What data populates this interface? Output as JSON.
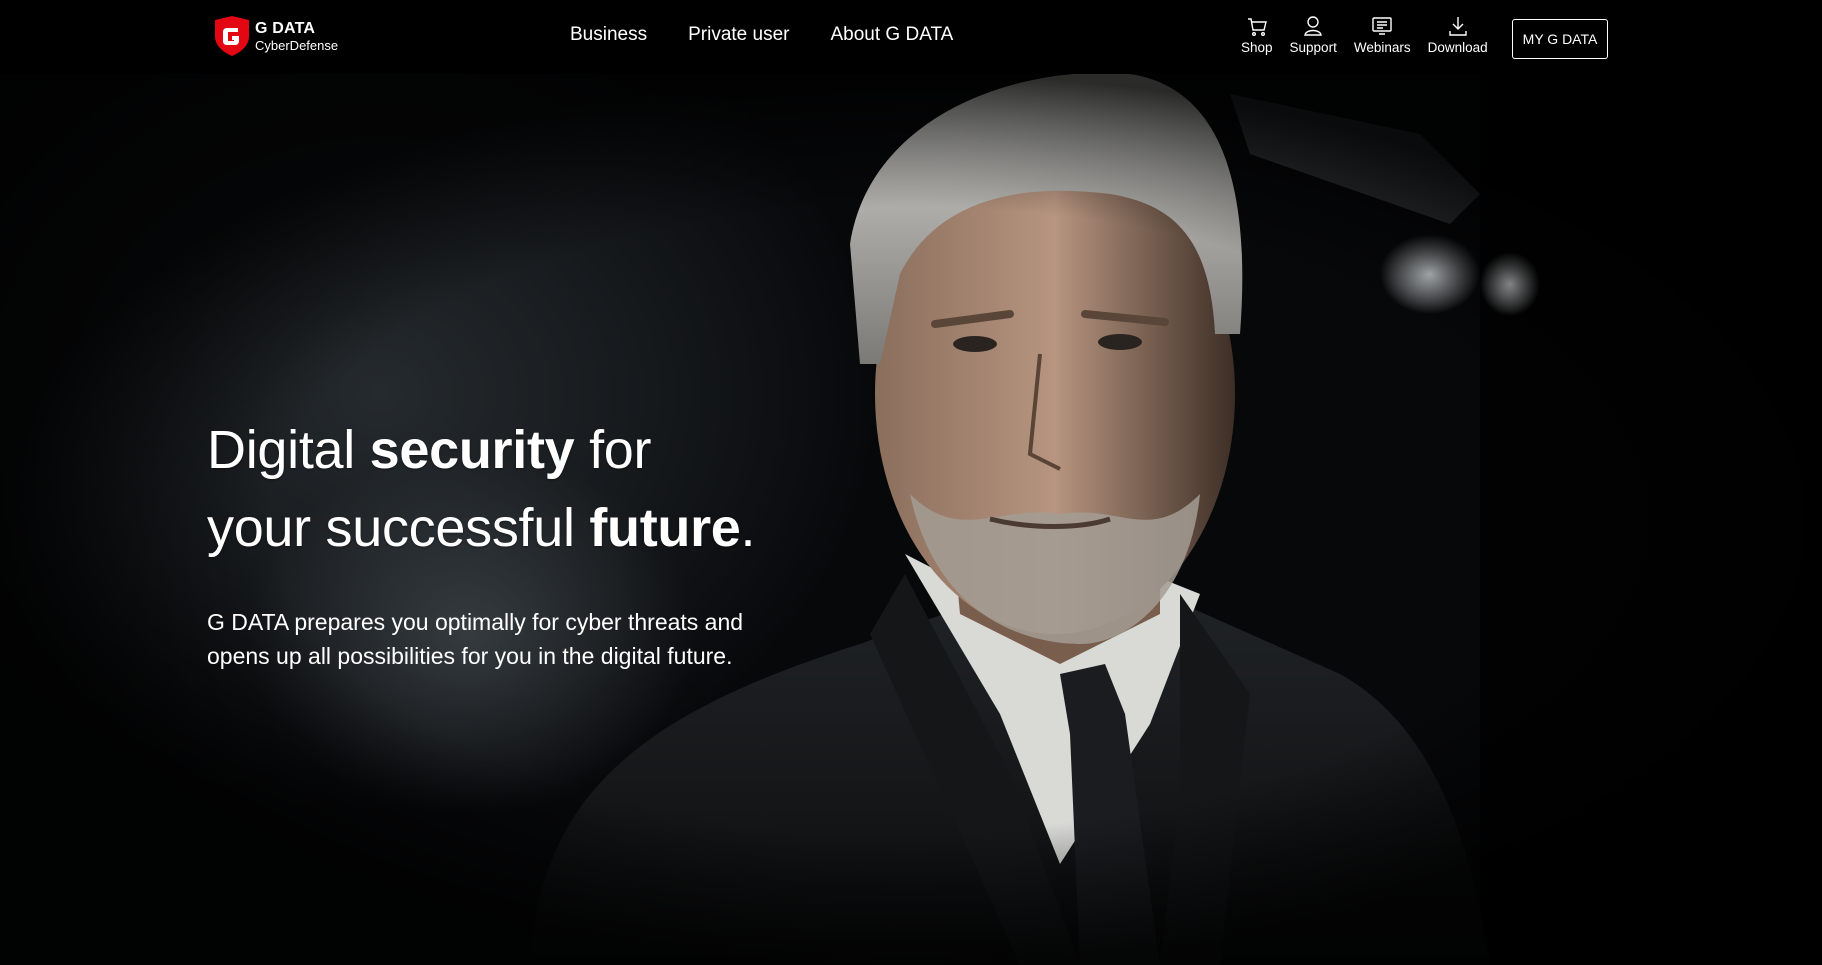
{
  "brand": {
    "name": "G DATA",
    "tagline": "CyberDefense",
    "color": "#e30613"
  },
  "main_nav": [
    {
      "label": "Business"
    },
    {
      "label": "Private user"
    },
    {
      "label": "About G DATA"
    }
  ],
  "utility_nav": [
    {
      "label": "Shop",
      "icon": "cart-icon"
    },
    {
      "label": "Support",
      "icon": "support-person-icon"
    },
    {
      "label": "Webinars",
      "icon": "webinar-screen-icon"
    },
    {
      "label": "Download",
      "icon": "download-icon"
    }
  ],
  "account_button": {
    "label": "MY G DATA"
  },
  "hero": {
    "title": {
      "part1": "Digital ",
      "bold1": "security",
      "part2": " for your successful ",
      "bold2": "future",
      "part3": "."
    },
    "text": "G DATA prepares you optimally for cyber threats and opens up all possibilities for you in the digital future."
  }
}
